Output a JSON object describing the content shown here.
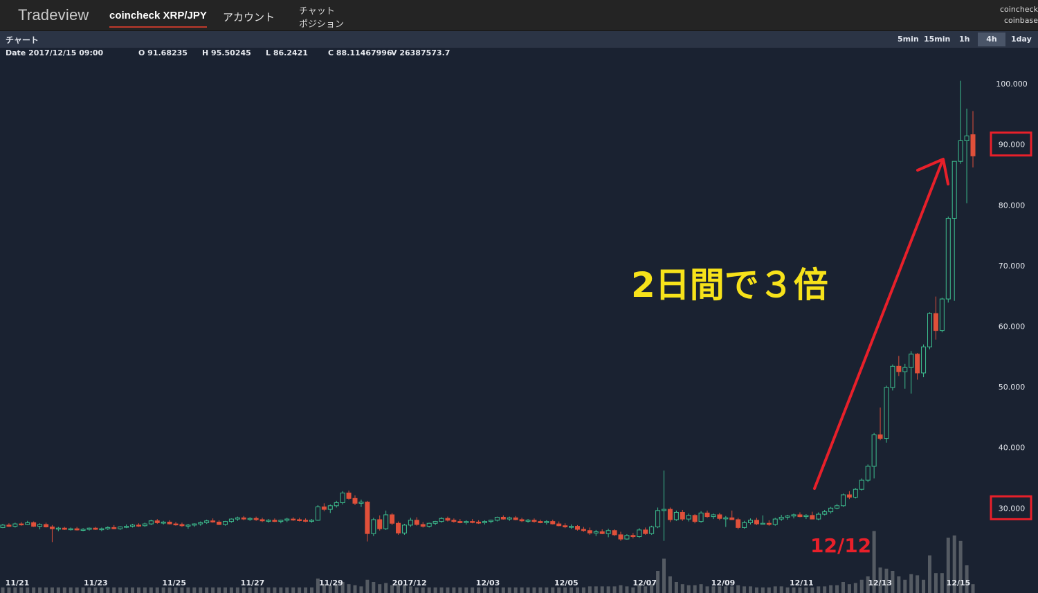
{
  "app": {
    "logo": "Tradeview",
    "nav": {
      "pair": "coincheck XRP/JPY",
      "account": "アカウント",
      "chat": "チャット",
      "position": "ポジション"
    },
    "exchanges": [
      "coincheck",
      "coinbase"
    ]
  },
  "panel": {
    "title": "チャート",
    "timeframes": [
      "5min",
      "15min",
      "1h",
      "4h",
      "1day"
    ],
    "active_timeframe": "4h"
  },
  "ohlc": {
    "date": "Date 2017/12/15 09:00",
    "open": "O 91.68235",
    "high": "H 95.50245",
    "low": "L 86.2421",
    "close": "C 88.11467996",
    "volume": "V 26387573.7"
  },
  "annotations": {
    "headline": "2日間で３倍",
    "date_label": "12/12",
    "color_headline": "#f7e21a",
    "color_red": "#e8202a"
  },
  "colors": {
    "up": "#3dbf8f",
    "down": "#e0503a",
    "volume": "#555b63",
    "highlight_box": "#e8202a",
    "arrow": "#e8202a"
  },
  "chart_data": {
    "type": "candlestick",
    "y_ticks": [
      "100.000",
      "90.000",
      "80.000",
      "70.000",
      "60.000",
      "50.000",
      "40.000",
      "30.000"
    ],
    "highlighted_ticks": [
      "90.000",
      "30.000"
    ],
    "ylim": [
      16,
      104
    ],
    "x_ticks": [
      "11/21",
      "11/23",
      "11/25",
      "11/27",
      "11/29",
      "2017/12",
      "12/03",
      "12/05",
      "12/07",
      "12/09",
      "12/11",
      "12/13",
      "12/15"
    ],
    "candles": [
      [
        26.8,
        27.4,
        26.7,
        27.2,
        0.05
      ],
      [
        27.2,
        27.5,
        26.9,
        27.0,
        0.05
      ],
      [
        27.0,
        27.6,
        26.8,
        27.4,
        0.05
      ],
      [
        27.4,
        27.7,
        27.1,
        27.3,
        0.05
      ],
      [
        27.3,
        27.9,
        27.2,
        27.6,
        0.05
      ],
      [
        27.6,
        27.8,
        26.9,
        27.0,
        0.05
      ],
      [
        27.0,
        27.5,
        26.5,
        27.3,
        0.05
      ],
      [
        27.3,
        27.6,
        26.8,
        26.9,
        0.05
      ],
      [
        26.9,
        27.2,
        24.4,
        26.6,
        0.05
      ],
      [
        26.6,
        26.9,
        26.2,
        26.7,
        0.05
      ],
      [
        26.7,
        26.9,
        26.4,
        26.5,
        0.05
      ],
      [
        26.5,
        26.8,
        26.3,
        26.6,
        0.05
      ],
      [
        26.6,
        26.9,
        26.3,
        26.4,
        0.05
      ],
      [
        26.4,
        26.7,
        26.2,
        26.5,
        0.05
      ],
      [
        26.5,
        26.8,
        26.3,
        26.7,
        0.05
      ],
      [
        26.7,
        26.9,
        26.4,
        26.5,
        0.05
      ],
      [
        26.5,
        26.8,
        26.2,
        26.6,
        0.05
      ],
      [
        26.6,
        27.0,
        26.4,
        26.8,
        0.05
      ],
      [
        26.8,
        27.2,
        26.5,
        26.6,
        0.05
      ],
      [
        26.6,
        27.0,
        26.4,
        26.9,
        0.05
      ],
      [
        26.9,
        27.3,
        26.7,
        27.0,
        0.05
      ],
      [
        27.0,
        27.4,
        26.8,
        27.2,
        0.05
      ],
      [
        27.2,
        27.5,
        26.9,
        27.1,
        0.05
      ],
      [
        27.1,
        27.6,
        26.9,
        27.4,
        0.05
      ],
      [
        27.4,
        28.1,
        27.2,
        27.9,
        0.05
      ],
      [
        27.9,
        28.2,
        27.4,
        27.6,
        0.05
      ],
      [
        27.6,
        27.9,
        27.3,
        27.7,
        0.05
      ],
      [
        27.7,
        28.0,
        27.3,
        27.4,
        0.05
      ],
      [
        27.4,
        27.7,
        27.1,
        27.3,
        0.05
      ],
      [
        27.3,
        27.6,
        26.9,
        27.1,
        0.05
      ],
      [
        27.1,
        27.4,
        26.6,
        27.2,
        0.05
      ],
      [
        27.2,
        27.5,
        26.9,
        27.4,
        0.05
      ],
      [
        27.4,
        27.8,
        27.1,
        27.6,
        0.05
      ],
      [
        27.6,
        28.1,
        27.4,
        27.9,
        0.05
      ],
      [
        27.9,
        28.3,
        27.6,
        27.7,
        0.05
      ],
      [
        27.7,
        28.0,
        27.2,
        27.3,
        0.05
      ],
      [
        27.3,
        27.9,
        27.1,
        27.8,
        0.05
      ],
      [
        27.8,
        28.3,
        27.6,
        28.2,
        0.05
      ],
      [
        28.2,
        28.6,
        27.9,
        28.4,
        0.05
      ],
      [
        28.4,
        28.7,
        28.0,
        28.2,
        0.05
      ],
      [
        28.2,
        28.5,
        27.9,
        28.3,
        0.05
      ],
      [
        28.3,
        28.6,
        27.9,
        28.1,
        0.05
      ],
      [
        28.1,
        28.4,
        27.7,
        27.9,
        0.05
      ],
      [
        27.9,
        28.2,
        27.6,
        28.0,
        0.05
      ],
      [
        28.0,
        28.3,
        27.7,
        27.8,
        0.05
      ],
      [
        27.8,
        28.1,
        27.5,
        28.0,
        0.05
      ],
      [
        28.0,
        28.4,
        27.7,
        28.2,
        0.05
      ],
      [
        28.2,
        28.5,
        27.9,
        28.1,
        0.05
      ],
      [
        28.1,
        28.4,
        27.8,
        28.0,
        0.05
      ],
      [
        28.0,
        28.3,
        27.7,
        27.9,
        0.05
      ],
      [
        27.9,
        28.2,
        27.6,
        28.0,
        0.05
      ],
      [
        28.0,
        30.5,
        27.9,
        30.2,
        0.13
      ],
      [
        30.2,
        30.8,
        29.5,
        29.8,
        0.08
      ],
      [
        29.8,
        30.6,
        29.2,
        30.4,
        0.07
      ],
      [
        30.4,
        31.2,
        30.1,
        30.9,
        0.08
      ],
      [
        30.9,
        32.8,
        30.6,
        32.5,
        0.1
      ],
      [
        32.5,
        32.9,
        31.4,
        31.6,
        0.08
      ],
      [
        31.6,
        32.1,
        30.5,
        30.8,
        0.07
      ],
      [
        30.8,
        31.4,
        30.2,
        31.0,
        0.06
      ],
      [
        31.0,
        31.2,
        24.5,
        25.8,
        0.12
      ],
      [
        25.8,
        28.4,
        25.4,
        28.1,
        0.1
      ],
      [
        28.1,
        28.8,
        26.3,
        26.6,
        0.08
      ],
      [
        26.6,
        29.6,
        26.4,
        28.9,
        0.09
      ],
      [
        28.9,
        29.2,
        27.2,
        27.5,
        0.07
      ],
      [
        27.5,
        27.8,
        25.6,
        25.9,
        0.08
      ],
      [
        25.9,
        27.4,
        25.6,
        27.2,
        0.07
      ],
      [
        27.2,
        28.4,
        26.9,
        28.0,
        0.06
      ],
      [
        28.0,
        28.5,
        27.1,
        27.3,
        0.05
      ],
      [
        27.3,
        27.7,
        26.8,
        27.0,
        0.05
      ],
      [
        27.0,
        27.6,
        26.8,
        27.5,
        0.05
      ],
      [
        27.5,
        27.9,
        27.2,
        27.8,
        0.05
      ],
      [
        27.8,
        28.5,
        27.6,
        28.3,
        0.05
      ],
      [
        28.3,
        28.6,
        27.8,
        28.0,
        0.05
      ],
      [
        28.0,
        28.3,
        27.6,
        27.8,
        0.05
      ],
      [
        27.8,
        28.2,
        27.5,
        27.6,
        0.05
      ],
      [
        27.6,
        28.0,
        27.3,
        27.8,
        0.05
      ],
      [
        27.8,
        28.2,
        27.5,
        27.7,
        0.05
      ],
      [
        27.7,
        28.0,
        27.4,
        27.6,
        0.05
      ],
      [
        27.6,
        28.0,
        27.3,
        27.8,
        0.05
      ],
      [
        27.8,
        28.1,
        27.5,
        28.0,
        0.05
      ],
      [
        28.0,
        28.6,
        27.8,
        28.5,
        0.05
      ],
      [
        28.5,
        28.8,
        28.1,
        28.2,
        0.05
      ],
      [
        28.2,
        28.6,
        27.9,
        28.4,
        0.05
      ],
      [
        28.4,
        28.7,
        28.0,
        28.1,
        0.05
      ],
      [
        28.1,
        28.4,
        27.7,
        27.9,
        0.05
      ],
      [
        27.9,
        28.2,
        27.6,
        28.0,
        0.05
      ],
      [
        28.0,
        28.3,
        27.6,
        27.8,
        0.05
      ],
      [
        27.8,
        28.1,
        27.5,
        27.6,
        0.05
      ],
      [
        27.6,
        28.0,
        27.3,
        27.8,
        0.05
      ],
      [
        27.8,
        28.1,
        27.3,
        27.4,
        0.05
      ],
      [
        27.4,
        27.8,
        27.0,
        27.1,
        0.05
      ],
      [
        27.1,
        27.5,
        26.7,
        26.9,
        0.05
      ],
      [
        26.9,
        27.3,
        26.6,
        27.0,
        0.05
      ],
      [
        27.0,
        27.2,
        26.3,
        26.5,
        0.05
      ],
      [
        26.5,
        26.9,
        26.1,
        26.3,
        0.05
      ],
      [
        26.3,
        26.8,
        25.6,
        25.9,
        0.06
      ],
      [
        25.9,
        26.4,
        25.4,
        26.1,
        0.06
      ],
      [
        26.1,
        26.5,
        25.7,
        25.8,
        0.06
      ],
      [
        25.8,
        26.6,
        25.2,
        26.3,
        0.06
      ],
      [
        26.3,
        26.5,
        25.4,
        25.6,
        0.06
      ],
      [
        25.6,
        26.1,
        24.6,
        24.9,
        0.07
      ],
      [
        24.9,
        25.7,
        24.8,
        25.5,
        0.06
      ],
      [
        25.5,
        25.9,
        25.0,
        25.3,
        0.05
      ],
      [
        25.3,
        26.7,
        25.1,
        26.4,
        0.07
      ],
      [
        26.4,
        26.8,
        25.6,
        25.8,
        0.06
      ],
      [
        25.8,
        27.1,
        25.6,
        26.9,
        0.08
      ],
      [
        26.9,
        30.1,
        26.7,
        29.6,
        0.2
      ],
      [
        29.6,
        36.2,
        24.6,
        29.8,
        0.31
      ],
      [
        29.8,
        30.1,
        27.7,
        28.1,
        0.15
      ],
      [
        28.1,
        29.6,
        27.9,
        29.3,
        0.1
      ],
      [
        29.3,
        29.7,
        27.9,
        28.2,
        0.08
      ],
      [
        28.2,
        29.1,
        27.8,
        28.8,
        0.07
      ],
      [
        28.8,
        29.0,
        27.5,
        27.8,
        0.07
      ],
      [
        27.8,
        29.5,
        27.6,
        29.2,
        0.08
      ],
      [
        29.2,
        29.6,
        28.4,
        28.6,
        0.06
      ],
      [
        28.6,
        29.1,
        28.2,
        28.9,
        0.06
      ],
      [
        28.9,
        29.2,
        28.0,
        28.3,
        0.06
      ],
      [
        28.3,
        28.7,
        26.9,
        28.4,
        0.06
      ],
      [
        28.4,
        29.6,
        28.1,
        28.1,
        0.06
      ],
      [
        28.1,
        28.4,
        26.5,
        26.8,
        0.07
      ],
      [
        26.8,
        27.9,
        26.6,
        27.6,
        0.06
      ],
      [
        27.6,
        28.3,
        27.3,
        28.0,
        0.06
      ],
      [
        28.0,
        28.4,
        27.2,
        27.4,
        0.05
      ],
      [
        27.4,
        28.8,
        27.3,
        27.5,
        0.05
      ],
      [
        27.5,
        28.0,
        27.1,
        27.3,
        0.05
      ],
      [
        27.3,
        28.4,
        27.1,
        28.2,
        0.06
      ],
      [
        28.2,
        28.9,
        27.9,
        28.5,
        0.06
      ],
      [
        28.5,
        28.9,
        28.1,
        28.7,
        0.05
      ],
      [
        28.7,
        29.1,
        28.3,
        28.9,
        0.05
      ],
      [
        28.9,
        29.3,
        28.5,
        28.6,
        0.05
      ],
      [
        28.6,
        29.0,
        28.2,
        28.8,
        0.05
      ],
      [
        28.8,
        29.4,
        28.5,
        28.2,
        0.05
      ],
      [
        28.2,
        29.3,
        28.0,
        29.0,
        0.06
      ],
      [
        29.0,
        29.7,
        28.8,
        29.4,
        0.06
      ],
      [
        29.4,
        30.2,
        29.1,
        30.0,
        0.07
      ],
      [
        30.0,
        30.7,
        29.8,
        30.4,
        0.07
      ],
      [
        30.4,
        32.4,
        30.2,
        32.2,
        0.1
      ],
      [
        32.2,
        32.8,
        31.5,
        31.8,
        0.08
      ],
      [
        31.8,
        33.3,
        31.6,
        33.1,
        0.09
      ],
      [
        33.1,
        34.9,
        32.9,
        34.6,
        0.12
      ],
      [
        34.6,
        37.2,
        34.3,
        36.9,
        0.15
      ],
      [
        36.9,
        42.4,
        34.9,
        42.1,
        0.56
      ],
      [
        42.1,
        46.6,
        41.2,
        41.5,
        0.23
      ],
      [
        41.5,
        50.2,
        40.8,
        49.9,
        0.22
      ],
      [
        49.9,
        53.7,
        49.4,
        53.4,
        0.2
      ],
      [
        53.4,
        55.1,
        51.8,
        52.5,
        0.15
      ],
      [
        52.5,
        53.8,
        49.7,
        53.2,
        0.12
      ],
      [
        53.2,
        55.9,
        48.9,
        55.4,
        0.17
      ],
      [
        55.4,
        55.6,
        51.2,
        52.3,
        0.16
      ],
      [
        52.3,
        57.0,
        51.6,
        56.6,
        0.12
      ],
      [
        56.6,
        62.3,
        56.2,
        62.1,
        0.34
      ],
      [
        62.1,
        64.9,
        57.8,
        59.3,
        0.18
      ],
      [
        59.3,
        64.7,
        59.0,
        64.5,
        0.18
      ],
      [
        64.5,
        78.1,
        63.9,
        77.8,
        0.5
      ],
      [
        77.8,
        81.9,
        64.2,
        87.2,
        0.52
      ],
      [
        87.2,
        100.5,
        86.8,
        90.6,
        0.47
      ],
      [
        90.6,
        95.9,
        80.3,
        91.4,
        0.25
      ],
      [
        91.6,
        95.5,
        86.2,
        88.1,
        0.08
      ]
    ]
  }
}
